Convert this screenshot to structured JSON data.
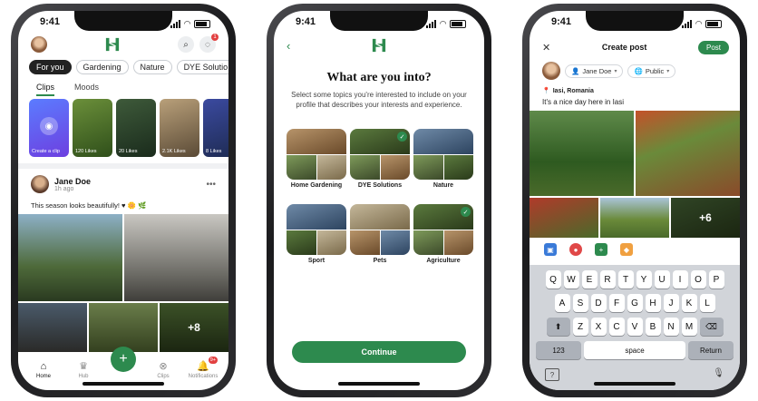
{
  "status": {
    "time": "9:41"
  },
  "feed": {
    "chips": [
      {
        "label": "For you",
        "active": true
      },
      {
        "label": "Gardening",
        "active": false
      },
      {
        "label": "Nature",
        "active": false
      },
      {
        "label": "DYE Solutio",
        "active": false
      }
    ],
    "notification_badge": "1",
    "subtabs": [
      "Clips",
      "Moods"
    ],
    "clips": [
      {
        "label": "Create a clip",
        "icon": "camera-icon"
      },
      {
        "label": "120 Likes"
      },
      {
        "label": "20 Likes"
      },
      {
        "label": "2.1K Likes"
      },
      {
        "label": "8 Likes"
      }
    ],
    "post": {
      "author": "Jane Doe",
      "time": "1h ago",
      "more": "•••",
      "text": "This season looks beautifully! ♥ 🌼 🌿",
      "more_photos": "+8"
    },
    "tabs": [
      {
        "label": "Home",
        "icon": "home-icon",
        "glyph": "⌂"
      },
      {
        "label": "Hub",
        "icon": "crown-icon",
        "glyph": "♛"
      },
      {
        "label": "",
        "icon": "add-icon",
        "glyph": "+"
      },
      {
        "label": "Clips",
        "icon": "clips-icon",
        "glyph": "⊗"
      },
      {
        "label": "Notifications",
        "icon": "bell-icon",
        "glyph": "🔔",
        "badge": "9+"
      }
    ]
  },
  "onboarding": {
    "back": "‹",
    "title": "What are you into?",
    "subtitle": "Select some topics you're interested to include on your profile that describes your interests and experience.",
    "topics": [
      {
        "label": "Home Gardening",
        "selected": false
      },
      {
        "label": "DYE Solutions",
        "selected": true
      },
      {
        "label": "Nature",
        "selected": false
      },
      {
        "label": "Sport",
        "selected": false
      },
      {
        "label": "Pets",
        "selected": false
      },
      {
        "label": "Agriculture",
        "selected": true
      }
    ],
    "continue_label": "Continue"
  },
  "create_post": {
    "close": "✕",
    "title": "Create post",
    "post_label": "Post",
    "user": "Jane Doe",
    "audience": "Public",
    "location": "Iasi, Romania",
    "text": "It's a nice day here in Iasi",
    "more_photos": "+6",
    "keyboard": {
      "row1": [
        "Q",
        "W",
        "E",
        "R",
        "T",
        "Y",
        "U",
        "I",
        "O",
        "P"
      ],
      "row2": [
        "A",
        "S",
        "D",
        "F",
        "G",
        "H",
        "J",
        "K",
        "L"
      ],
      "row3": [
        "Z",
        "X",
        "C",
        "V",
        "B",
        "N",
        "M"
      ],
      "shift": "⬆",
      "backspace": "⌫",
      "numbers": "123",
      "space": "space",
      "return": "Return",
      "emoji": "?",
      "mic": "🎙"
    }
  },
  "colors": {
    "accent": "#2d8a4e",
    "badge": "#e24040"
  }
}
